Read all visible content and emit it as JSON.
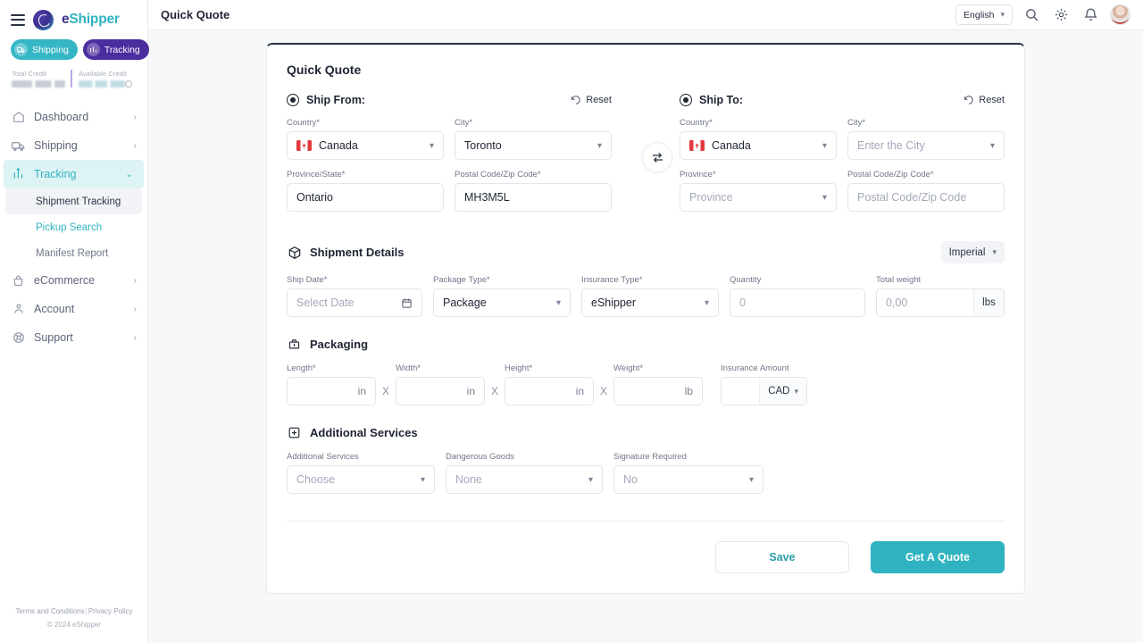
{
  "brand": {
    "name_part1": "e",
    "name_part2": "Shipper",
    "logo_icon": "eshipper-logo-icon"
  },
  "sidebar": {
    "hamburger_icon": "hamburger-menu-icon",
    "pills": [
      {
        "label": "Shipping",
        "icon": "truck-icon",
        "color": "#35b6c4"
      },
      {
        "label": "Tracking",
        "icon": "tracking-icon",
        "color": "#4b2d9f"
      }
    ],
    "credits": [
      {
        "label": "Total Credit",
        "value": ""
      },
      {
        "label": "Available Credit",
        "value": ""
      }
    ],
    "nav": [
      {
        "label": "Dashboard",
        "icon": "home-icon",
        "chevron": "›",
        "state": "normal"
      },
      {
        "label": "Shipping",
        "icon": "truck-icon",
        "chevron": "›",
        "state": "normal"
      },
      {
        "label": "Tracking",
        "icon": "tracking-icon",
        "chevron": "⌄",
        "state": "active"
      },
      {
        "label": "eCommerce",
        "icon": "bag-icon",
        "chevron": "›",
        "state": "normal"
      },
      {
        "label": "Account",
        "icon": "user-icon",
        "chevron": "›",
        "state": "normal"
      },
      {
        "label": "Support",
        "icon": "support-icon",
        "chevron": "›",
        "state": "normal"
      }
    ],
    "subnav": [
      {
        "label": "Shipment Tracking",
        "state": "hover"
      },
      {
        "label": "Pickup Search",
        "state": "selected"
      },
      {
        "label": "Manifest Report",
        "state": "normal"
      }
    ],
    "footer": {
      "terms": "Terms and Conditions",
      "separator": "|",
      "privacy": "Privacy Policy",
      "copyright": "© 2024 eShipper"
    }
  },
  "topbar": {
    "title": "Quick Quote",
    "language": "English",
    "icons": [
      "search-icon",
      "gear-icon",
      "bell-icon"
    ],
    "avatar": "user-avatar"
  },
  "card": {
    "title": "Quick Quote",
    "ship_from": {
      "heading": "Ship From:",
      "reset_label": "Reset",
      "reset_icon": "reset-icon",
      "country": {
        "label": "Country*",
        "value": "Canada",
        "flag": "canada-flag"
      },
      "city": {
        "label": "City*",
        "value": "Toronto"
      },
      "province": {
        "label": "Province/State*",
        "value": "Ontario"
      },
      "postal": {
        "label": "Postal Code/Zip Code*",
        "value": "MH3M5L"
      }
    },
    "ship_to": {
      "heading": "Ship To:",
      "reset_label": "Reset",
      "reset_icon": "reset-icon",
      "country": {
        "label": "Country*",
        "value": "Canada",
        "flag": "canada-flag"
      },
      "city": {
        "label": "City*",
        "placeholder": "Enter the City"
      },
      "province": {
        "label": "Province*",
        "placeholder": "Province"
      },
      "postal": {
        "label": "Postal Code/Zip Code*",
        "placeholder": "Postal Code/Zip Code"
      }
    },
    "swap_icon": "swap-arrows-icon",
    "shipment_details": {
      "title": "Shipment Details",
      "icon": "box-icon",
      "unit_system": "Imperial",
      "ship_date": {
        "label": "Ship Date*",
        "placeholder": "Select Date",
        "icon": "calendar-icon"
      },
      "package_type": {
        "label": "Package Type*",
        "value": "Package"
      },
      "insurance_type": {
        "label": "Insurance Type*",
        "value": "eShipper"
      },
      "quantity": {
        "label": "Quantity",
        "placeholder": "0"
      },
      "total_weight": {
        "label": "Total weight",
        "placeholder": "0,00",
        "unit": "lbs"
      }
    },
    "packaging": {
      "title": "Packaging",
      "icon": "packaging-icon",
      "length": {
        "label": "Length*",
        "unit": "in"
      },
      "width": {
        "label": "Width*",
        "unit": "in"
      },
      "height": {
        "label": "Height*",
        "unit": "in"
      },
      "weight": {
        "label": "Weight*",
        "unit": "lb"
      },
      "separator": "X",
      "insurance_amount": {
        "label": "Insurance Amount",
        "currency": "CAD"
      }
    },
    "additional_services": {
      "title": "Additional Services",
      "icon": "plus-box-icon",
      "services": {
        "label": "Additional Services",
        "placeholder": "Choose"
      },
      "dangerous_goods": {
        "label": "Dangerous Goods",
        "placeholder": "None"
      },
      "signature_required": {
        "label": "Signature Required",
        "placeholder": "No"
      }
    },
    "actions": {
      "save": "Save",
      "quote": "Get A Quote"
    }
  },
  "colors": {
    "accent_teal": "#2fb3c0",
    "purple": "#4b2d9f",
    "dark": "#1f2533"
  }
}
